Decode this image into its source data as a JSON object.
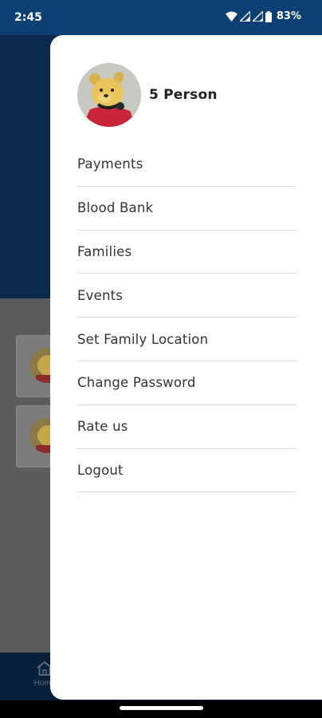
{
  "status_bar": {
    "time": "2:45",
    "battery_percent": "83%",
    "icons": [
      "wifi-icon",
      "signal-icon",
      "signal-icon",
      "battery-icon"
    ]
  },
  "background": {
    "bottom_nav": {
      "home_label": "Home",
      "home_icon": "home-icon"
    }
  },
  "drawer": {
    "profile": {
      "name": "5 Person",
      "avatar_icon": "bear-avatar"
    },
    "menu": [
      {
        "label": "Payments"
      },
      {
        "label": "Blood Bank"
      },
      {
        "label": "Families"
      },
      {
        "label": "Events"
      },
      {
        "label": "Set Family Location"
      },
      {
        "label": "Change Password"
      },
      {
        "label": "Rate us"
      },
      {
        "label": "Logout"
      }
    ]
  },
  "colors": {
    "status_bar": "#0c3f73",
    "scrim": "#5b5b5b",
    "drawer_bg": "#ffffff",
    "divider": "#dcdcdc"
  }
}
